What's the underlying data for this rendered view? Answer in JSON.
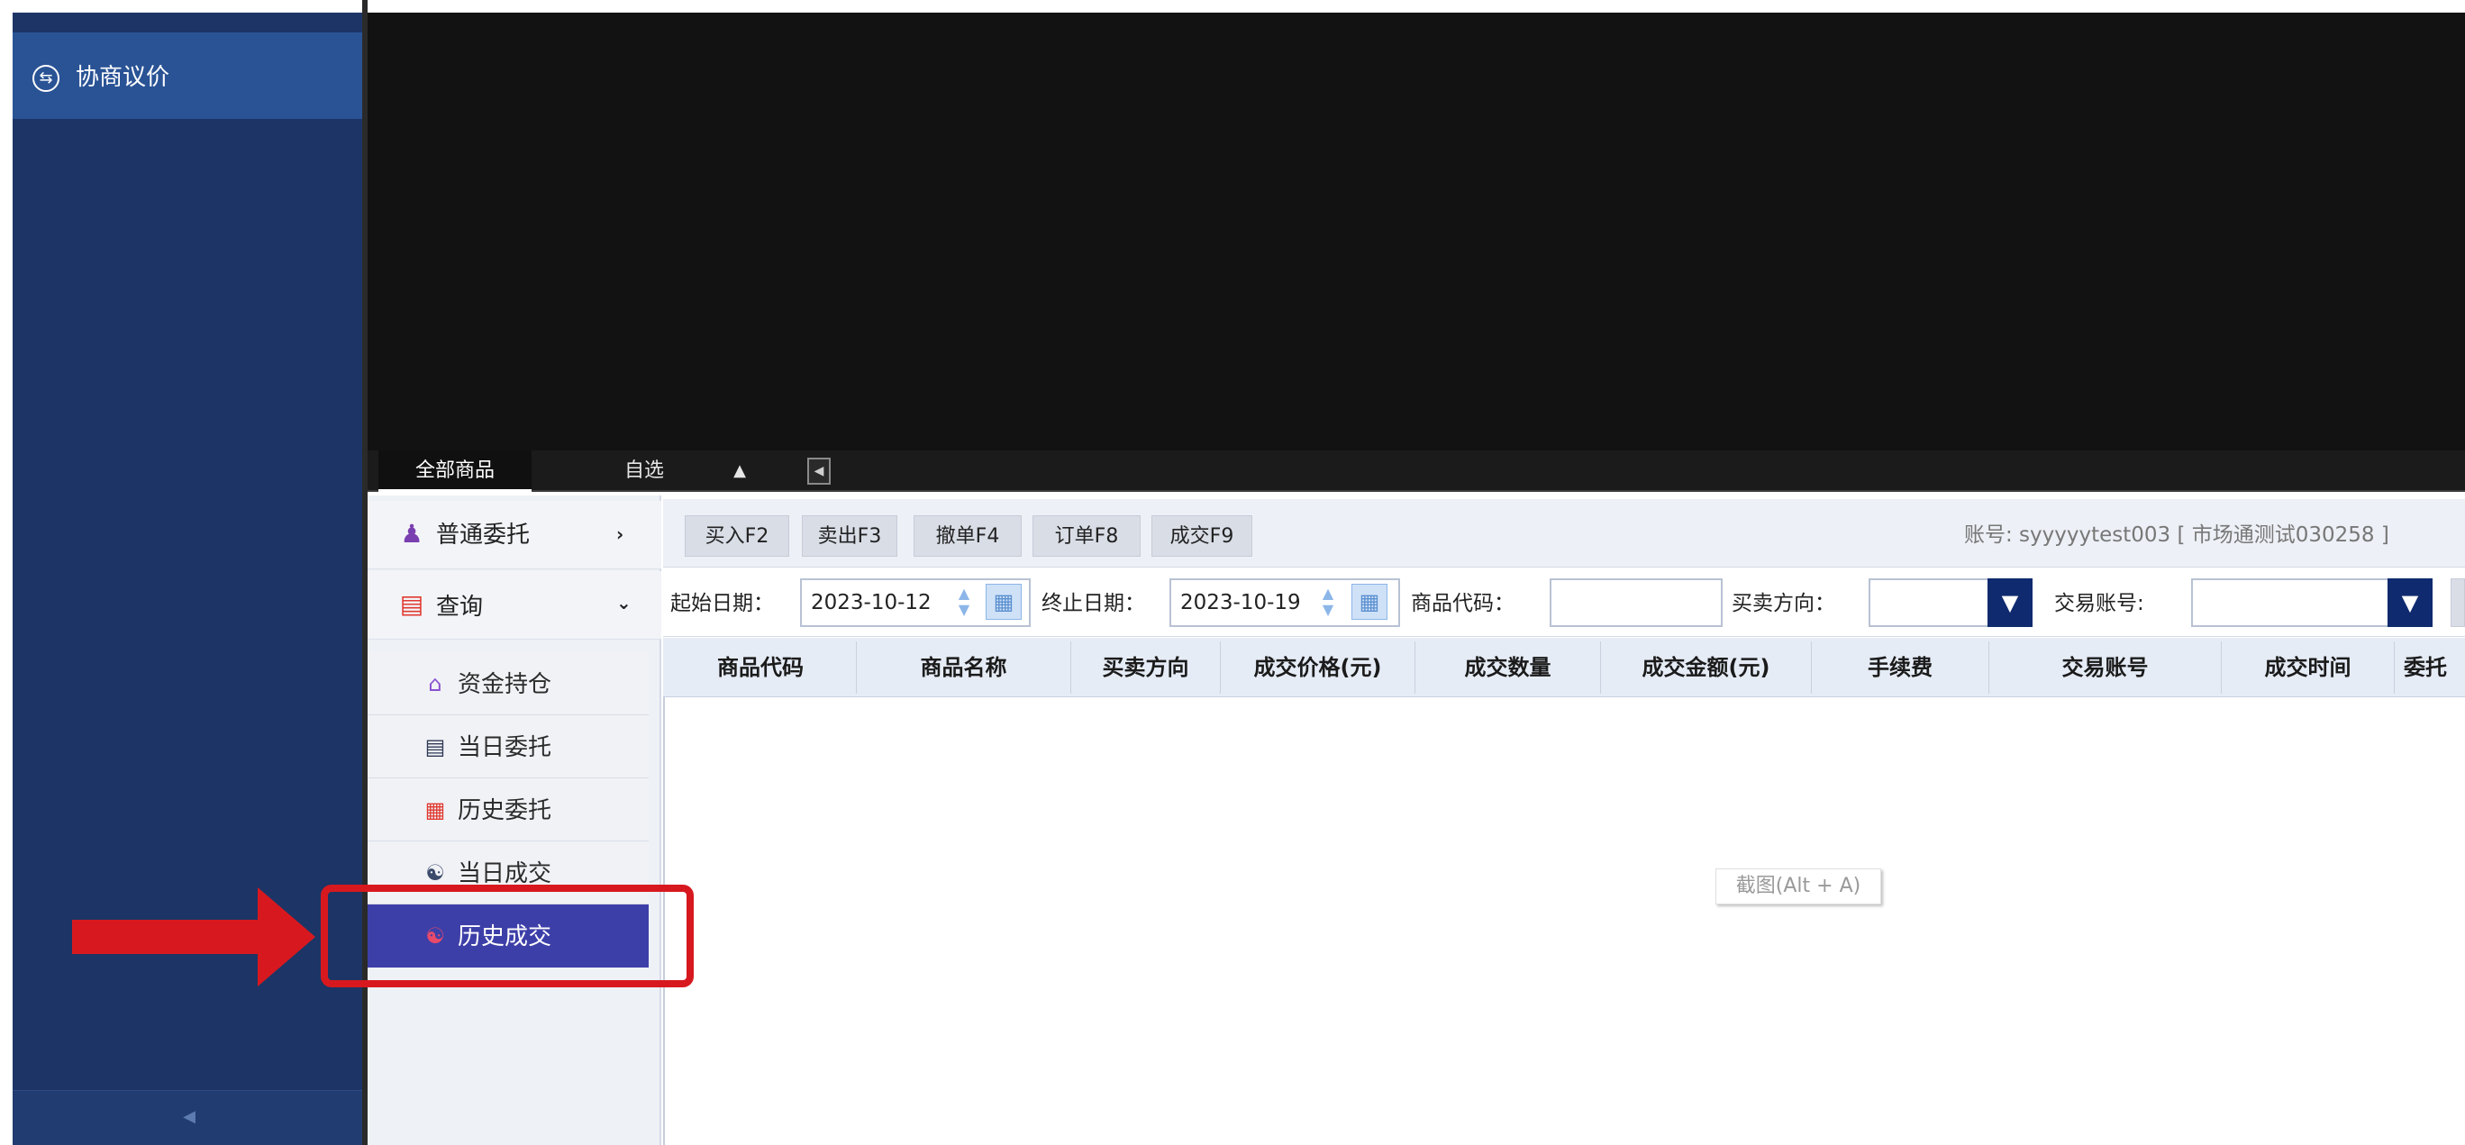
{
  "sidebar": {
    "nav_item": "协商议价",
    "icon": "exchange-icon",
    "collapse_icon": "chevron-left-icon"
  },
  "market_tabs": {
    "items": [
      "全部商品",
      "自选"
    ],
    "up_icon": "triangle-up-icon",
    "left_icon": "arrow-left-icon"
  },
  "menu": {
    "groups": [
      {
        "label": "普通委托",
        "icon": "user-icon",
        "chevron": "›"
      },
      {
        "label": "查询",
        "icon": "query-icon",
        "chevron": "⌄"
      }
    ],
    "sub_items": [
      {
        "label": "资金持仓",
        "icon": "house-icon"
      },
      {
        "label": "当日委托",
        "icon": "document-icon"
      },
      {
        "label": "历史委托",
        "icon": "calendar-doc-icon"
      },
      {
        "label": "当日成交",
        "icon": "handshake-icon"
      },
      {
        "label": "历史成交",
        "icon": "handshake-icon",
        "active": true
      }
    ]
  },
  "toolbar": {
    "buttons": [
      "买入F2",
      "卖出F3",
      "撤单F4",
      "订单F8",
      "成交F9"
    ],
    "account": "账号: syyyyytest003 [ 市场通测试030258 ]"
  },
  "filters": {
    "start_label": "起始日期：",
    "start_value": "2023-10-12",
    "end_label": "终止日期：",
    "end_value": "2023-10-19",
    "code_label": "商品代码：",
    "code_value": "",
    "direction_label": "买卖方向：",
    "direction_value": "",
    "account_label": "交易账号:",
    "account_value": ""
  },
  "table": {
    "columns": [
      "商品代码",
      "商品名称",
      "买卖方向",
      "成交价格(元)",
      "成交数量",
      "成交金额(元)",
      "手续费",
      "交易账号",
      "成交时间",
      "委托"
    ],
    "rows": []
  },
  "tooltip": "截图(Alt + A)",
  "colors": {
    "nav_bg": "#1c3566",
    "nav_active": "#2a5395",
    "menu_active": "#3d3fa8",
    "annotation_red": "#d7191f"
  }
}
